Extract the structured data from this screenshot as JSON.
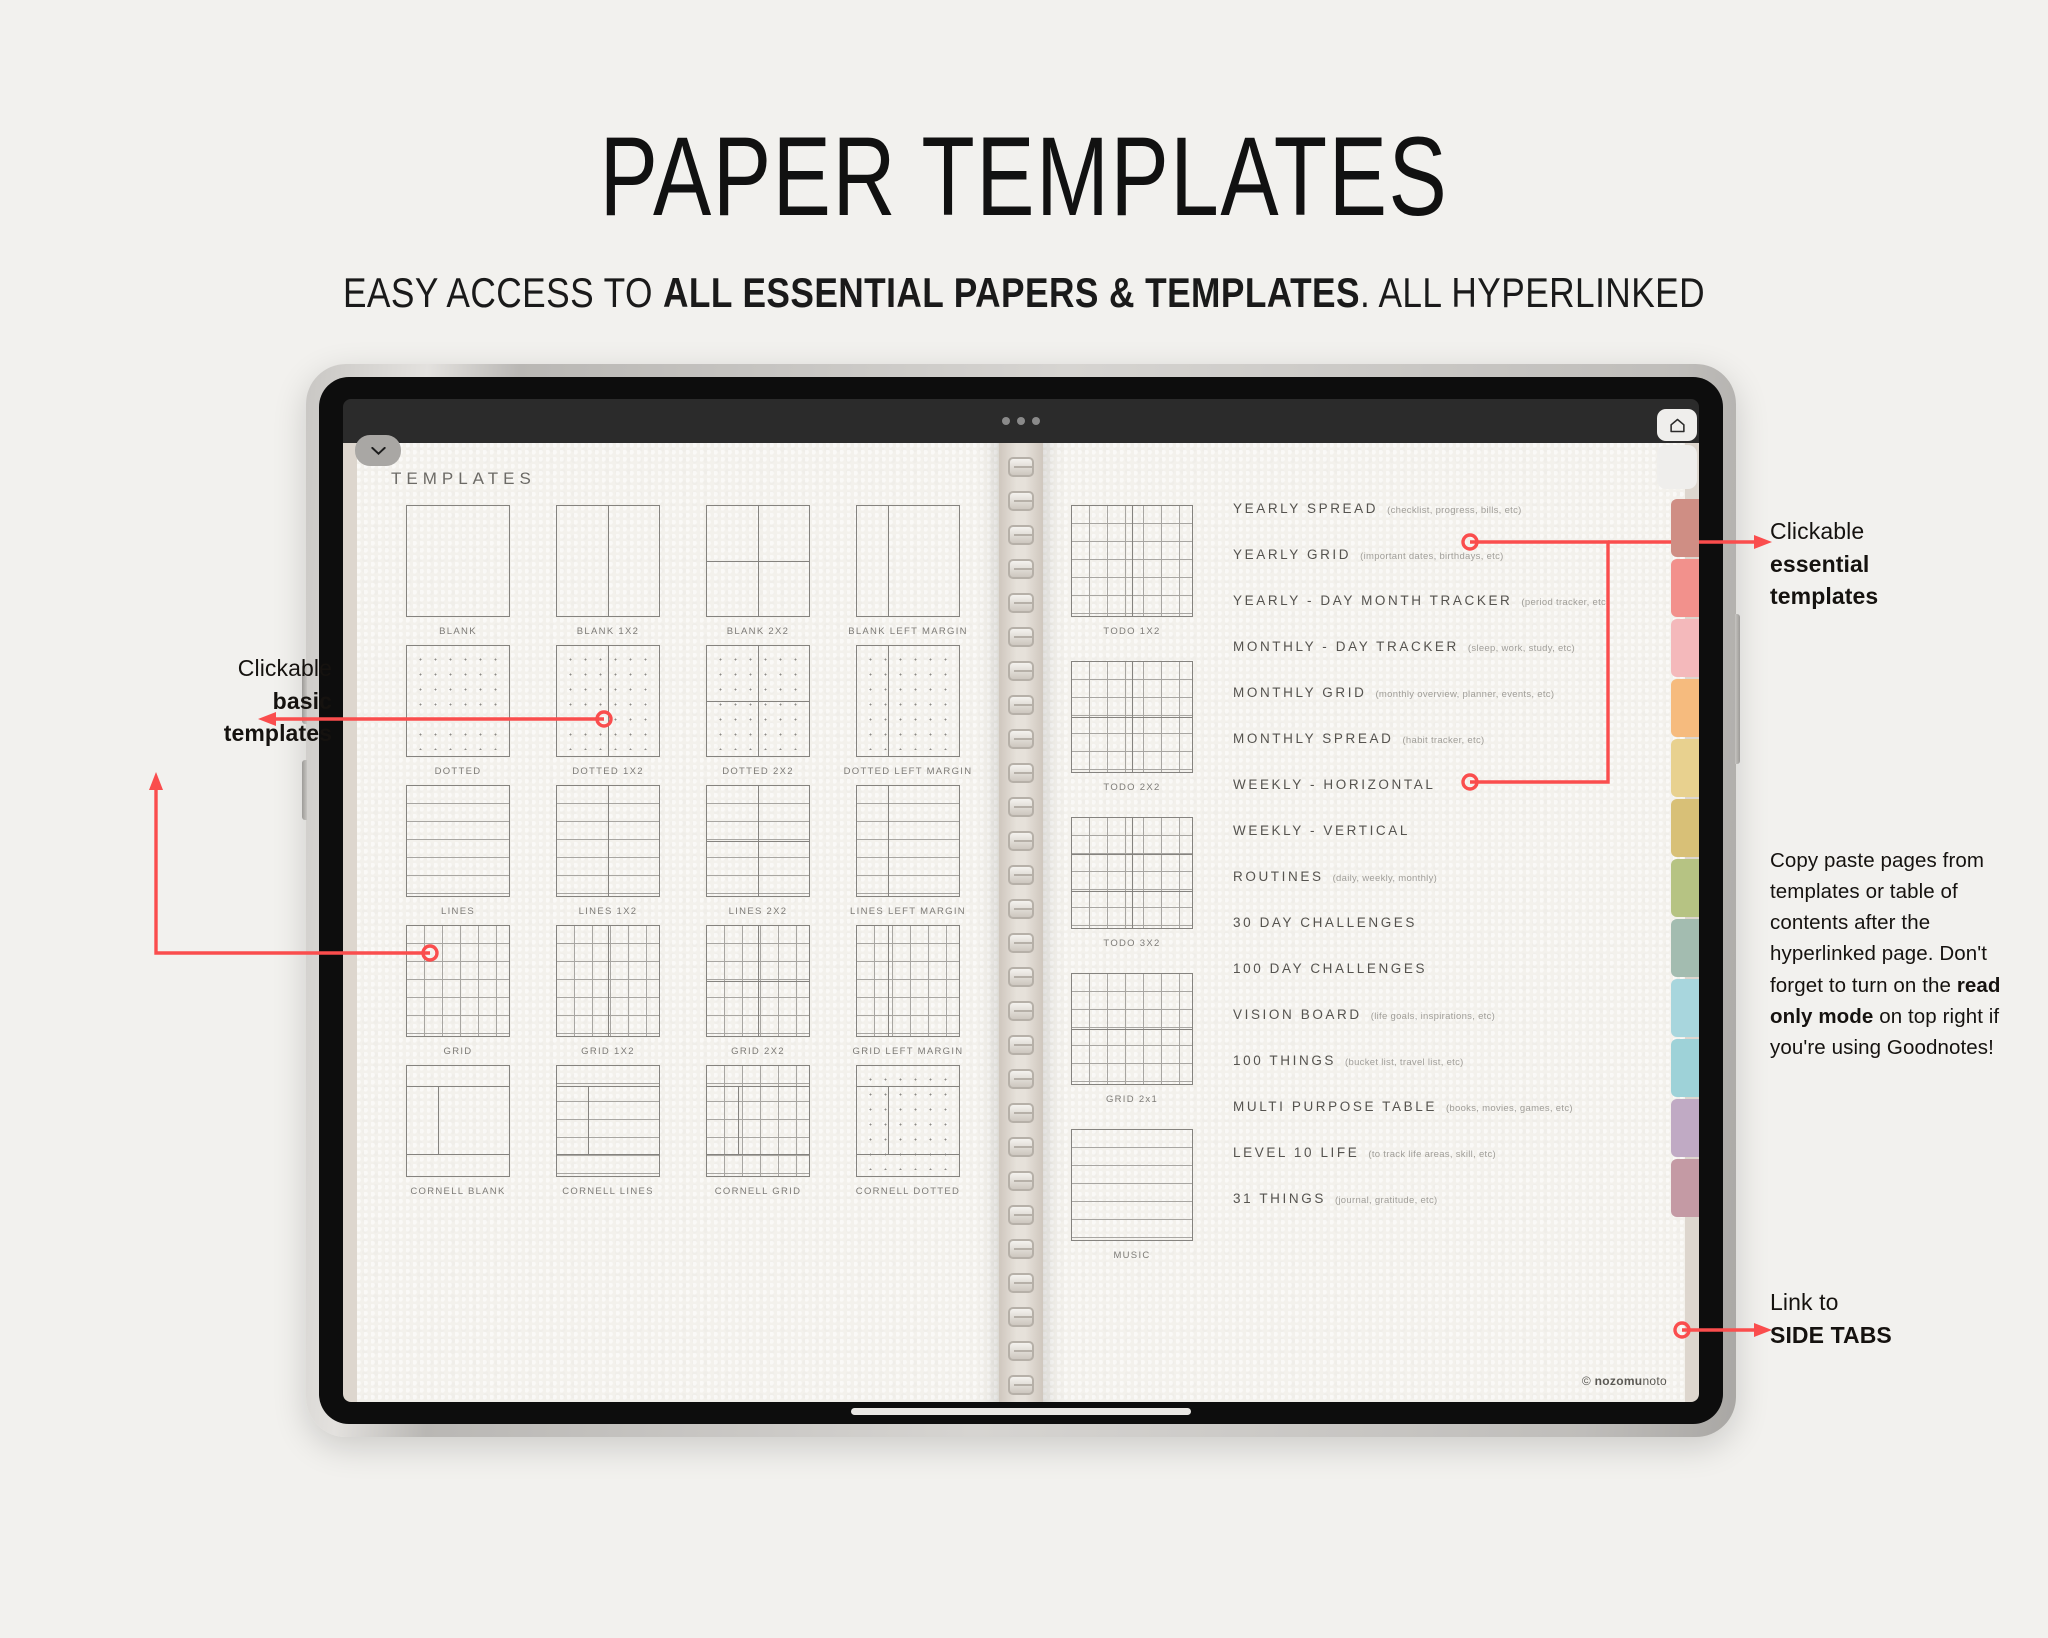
{
  "header": {
    "title": "PAPER TEMPLATES",
    "subtitle_pre": "EASY ACCESS TO ",
    "subtitle_bold": "ALL ESSENTIAL PAPERS & TEMPLATES",
    "subtitle_post": ". ALL HYPERLINKED"
  },
  "annotations": {
    "left": {
      "line1": "Clickable",
      "line2": "basic",
      "line3": "templates"
    },
    "right_top": {
      "line1": "Clickable",
      "line2": "essential",
      "line3": "templates"
    },
    "paragraph": {
      "part1": "Copy paste pages from templates or table of contents after the hyperlinked page. Don't forget to turn on the ",
      "bold": "read only mode",
      "part2": " on top right if you're using Goodnotes!"
    },
    "bottom_right": {
      "line1": "Link to",
      "line2": "SIDE TABS"
    }
  },
  "app": {
    "collapse_icon": "chevron-down-icon",
    "handle_icon": "multitask-dots-icon",
    "home_icon": "home-icon",
    "watermark_copyright": "©",
    "watermark_bold": "nozomu",
    "watermark_rest": "noto"
  },
  "left_page": {
    "heading": "TEMPLATES",
    "templates": [
      {
        "label": "BLANK",
        "kind": "blank",
        "split": "none"
      },
      {
        "label": "BLANK 1X2",
        "kind": "blank",
        "split": "1x2"
      },
      {
        "label": "BLANK 2X2",
        "kind": "blank",
        "split": "2x2"
      },
      {
        "label": "BLANK LEFT MARGIN",
        "kind": "blank",
        "split": "margin"
      },
      {
        "label": "DOTTED",
        "kind": "dotted",
        "split": "none"
      },
      {
        "label": "DOTTED 1X2",
        "kind": "dotted",
        "split": "1x2"
      },
      {
        "label": "DOTTED 2X2",
        "kind": "dotted",
        "split": "2x2"
      },
      {
        "label": "DOTTED LEFT MARGIN",
        "kind": "dotted",
        "split": "margin"
      },
      {
        "label": "LINES",
        "kind": "lines",
        "split": "none"
      },
      {
        "label": "LINES 1X2",
        "kind": "lines",
        "split": "1x2"
      },
      {
        "label": "LINES 2X2",
        "kind": "lines",
        "split": "2x2"
      },
      {
        "label": "LINES LEFT MARGIN",
        "kind": "lines",
        "split": "margin"
      },
      {
        "label": "GRID",
        "kind": "grid",
        "split": "none"
      },
      {
        "label": "GRID 1X2",
        "kind": "grid",
        "split": "1x2"
      },
      {
        "label": "GRID 2X2",
        "kind": "grid",
        "split": "2x2"
      },
      {
        "label": "GRID LEFT MARGIN",
        "kind": "grid",
        "split": "margin"
      },
      {
        "label": "CORNELL BLANK",
        "kind": "cornell-blank",
        "split": "cornell"
      },
      {
        "label": "CORNELL LINES",
        "kind": "cornell-lines",
        "split": "cornell"
      },
      {
        "label": "CORNELL GRID",
        "kind": "cornell-grid",
        "split": "cornell"
      },
      {
        "label": "CORNELL DOTTED",
        "kind": "cornell-dotted",
        "split": "cornell"
      }
    ]
  },
  "right_page": {
    "thumbnails": [
      {
        "label": "TODO 1X2",
        "kind": "todo1x2"
      },
      {
        "label": "TODO 2X2",
        "kind": "todo2x2"
      },
      {
        "label": "TODO 3X2",
        "kind": "todo3x2"
      },
      {
        "label": "GRID 2x1",
        "kind": "grid2x1"
      },
      {
        "label": "MUSIC",
        "kind": "music"
      }
    ],
    "list": [
      {
        "main": "YEARLY SPREAD",
        "note": "(checklist, progress, bills, etc)"
      },
      {
        "main": "YEARLY GRID",
        "note": "(important dates, birthdays, etc)"
      },
      {
        "main": "YEARLY - DAY MONTH TRACKER",
        "note": "(period tracker, etc)"
      },
      {
        "main": "MONTHLY - DAY TRACKER",
        "note": "(sleep, work, study, etc)"
      },
      {
        "main": "MONTHLY GRID",
        "note": "(monthly overview, planner, events, etc)"
      },
      {
        "main": "MONTHLY SPREAD",
        "note": "(habit tracker, etc)"
      },
      {
        "main": "WEEKLY - HORIZONTAL",
        "note": ""
      },
      {
        "main": "WEEKLY - VERTICAL",
        "note": ""
      },
      {
        "main": "ROUTINES",
        "note": "(daily, weekly, monthly)"
      },
      {
        "main": "30 DAY CHALLENGES",
        "note": ""
      },
      {
        "main": "100 DAY CHALLENGES",
        "note": ""
      },
      {
        "main": "VISION BOARD",
        "note": "(life goals, inspirations, etc)"
      },
      {
        "main": "100 THINGS",
        "note": "(bucket list, travel list, etc)"
      },
      {
        "main": "MULTI PURPOSE TABLE",
        "note": "(books, movies, games, etc)"
      },
      {
        "main": "LEVEL 10 LIFE",
        "note": "(to track life areas, skill, etc)"
      },
      {
        "main": "31 THINGS",
        "note": "(journal, gratitude, etc)"
      }
    ]
  },
  "side_tabs": {
    "colors": [
      "#cf8e84",
      "#f2918c",
      "#f4b9bb",
      "#f6bb7e",
      "#e8d18f",
      "#d8c077",
      "#b6c383",
      "#a3bcb0",
      "#a8d6dd",
      "#9ed2d8",
      "#c0aac4",
      "#c49aa4"
    ]
  },
  "colors": {
    "accent": "#fa4d4d",
    "page_bg": "#f2f1ee",
    "paper": "#f3f1ec"
  }
}
